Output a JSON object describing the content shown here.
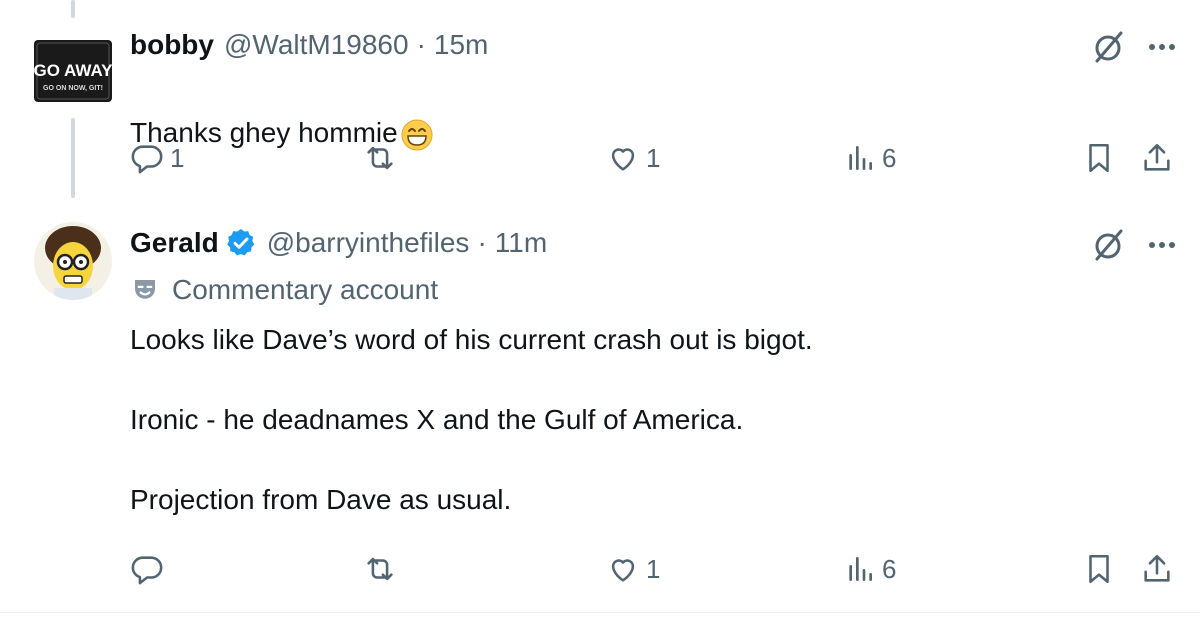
{
  "tweets": [
    {
      "author": "bobby",
      "handle": "@WaltM19860",
      "separator": "·",
      "time": "15m",
      "text": "Thanks ghey hommie",
      "emoji": "grinning-face-with-smiling-eyes",
      "avatar_text_main": "GO AWAY",
      "avatar_text_sub": "GO ON NOW, GIT!",
      "replies": "1",
      "reposts": "",
      "likes": "1",
      "views": "6"
    },
    {
      "author": "Gerald",
      "handle": "@barryinthefiles",
      "separator": "·",
      "time": "11m",
      "verified": true,
      "label": "Commentary account",
      "text": "Looks like Dave’s word of his current crash out is bigot.\n\nIronic - he deadnames X and the Gulf of America.\n\nProjection from Dave as usual.",
      "replies": "",
      "reposts": "",
      "likes": "1",
      "views": "6"
    }
  ],
  "colors": {
    "text": "#0f1419",
    "secondary": "#536471",
    "verified": "#1d9bf0",
    "thread_line": "#cfd9de"
  },
  "icons": [
    "grok-icon",
    "more-icon",
    "reply-icon",
    "repost-icon",
    "like-icon",
    "views-icon",
    "bookmark-icon",
    "share-icon",
    "verified-badge-icon",
    "commentary-mask-icon"
  ]
}
